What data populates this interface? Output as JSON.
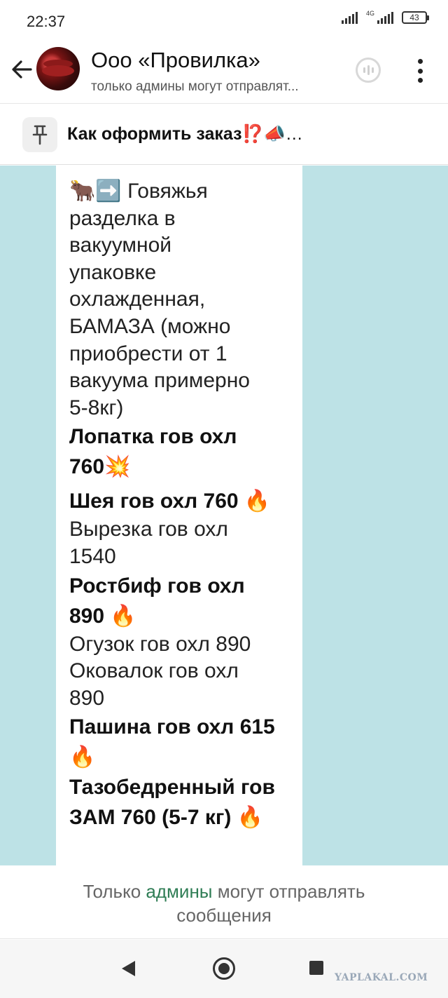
{
  "status_bar": {
    "time": "22:37",
    "network_label": "4G",
    "battery": "43"
  },
  "header": {
    "title": "Ооо «Провилка»",
    "subtitle": "только админы могут отправлят..."
  },
  "pinned": {
    "text": "Как оформить заказ",
    "emoji": "⁉️📣…"
  },
  "message": {
    "lines": [
      {
        "text": "Говяжья",
        "prefix_emoji": "🐂➡️",
        "bold": false
      },
      {
        "text": "разделка в",
        "bold": false
      },
      {
        "text": "вакуумной",
        "bold": false
      },
      {
        "text": "упаковке",
        "bold": false
      },
      {
        "text": "охлажденная,",
        "bold": false
      },
      {
        "text": "БАМАЗА  (можно",
        "bold": false
      },
      {
        "text": "приобрести от 1",
        "bold": false
      },
      {
        "text": "вакуума примерно",
        "bold": false
      },
      {
        "text": "5-8кг)",
        "bold": false
      },
      {
        "text": "Лопатка гов охл",
        "bold": true
      },
      {
        "text": "760",
        "emoji": "💥",
        "bold": true
      },
      {
        "text": "Шея гов охл 760 ",
        "emoji": "🔥",
        "bold": true
      },
      {
        "text": "Вырезка гов охл",
        "bold": false
      },
      {
        "text": "1540",
        "bold": false
      },
      {
        "text": "Ростбиф гов охл",
        "bold": true
      },
      {
        "text": "890 ",
        "emoji": "🔥",
        "bold": true
      },
      {
        "text": "Огузок гов охл 890",
        "bold": false
      },
      {
        "text": "Оковалок гов охл",
        "bold": false
      },
      {
        "text": "890",
        "bold": false
      },
      {
        "text": "Пашина гов охл 615",
        "bold": true
      },
      {
        "text": "",
        "emoji": "🔥",
        "bold": true
      },
      {
        "text": "Тазобедренный гов",
        "bold": true
      },
      {
        "text": "ЗАМ 760 (5-7 кг) ",
        "emoji": "🔥",
        "bold": true
      }
    ]
  },
  "footer": {
    "part1": "Только ",
    "link": "админы",
    "part2": " могут отправлять",
    "line2": "сообщения"
  },
  "watermark": "YAPLAKAL.COM",
  "colors": {
    "chat_background": "#bde2e6",
    "link_green": "#2f7d55"
  }
}
